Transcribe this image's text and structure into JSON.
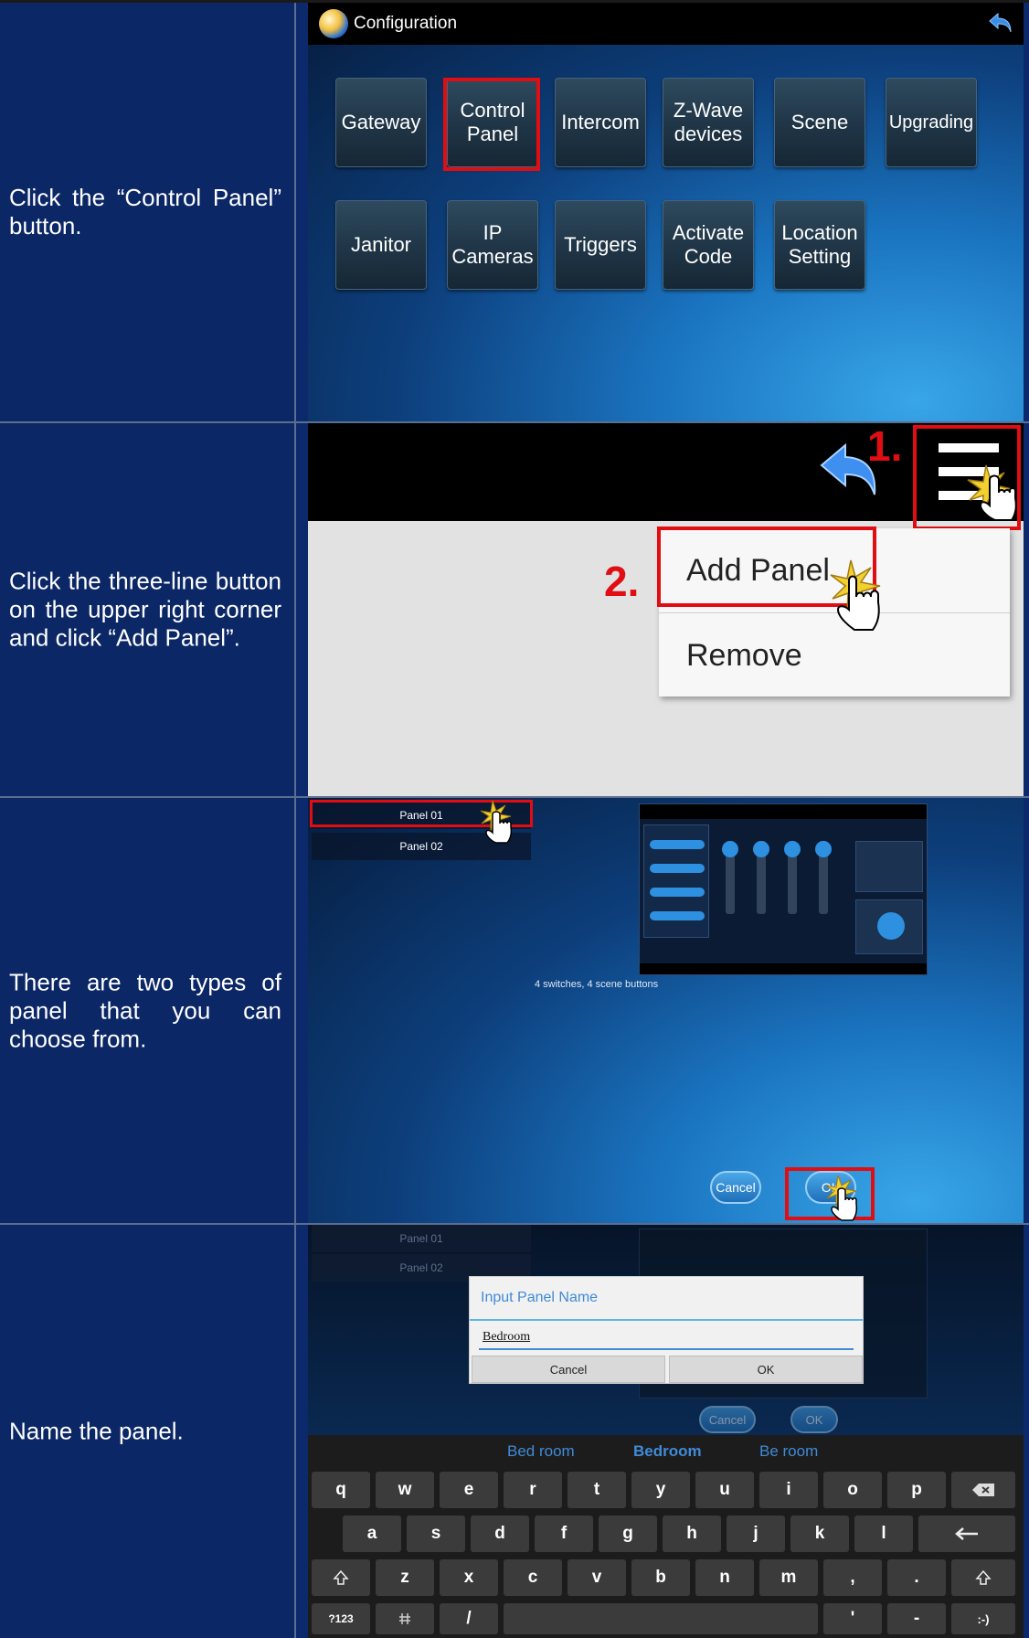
{
  "steps": [
    {
      "description": "Click the “Control Panel” button."
    },
    {
      "description": "Click the three-line button on the upper right corner and click “Add Panel”."
    },
    {
      "description": "There are two types of panel that you can choose from."
    },
    {
      "description": "Name the panel."
    }
  ],
  "config_screen": {
    "title": "Configuration",
    "tiles": [
      {
        "label": "Gateway"
      },
      {
        "label": "Control Panel",
        "highlighted": true
      },
      {
        "label": "Intercom"
      },
      {
        "label": "Z-Wave devices"
      },
      {
        "label": "Scene"
      },
      {
        "label": "Upgrading"
      },
      {
        "label": "Janitor"
      },
      {
        "label": "IP Cameras"
      },
      {
        "label": "Triggers"
      },
      {
        "label": "Activate Code"
      },
      {
        "label": "Location Setting"
      }
    ]
  },
  "menu_screen": {
    "step1_marker": "1.",
    "step2_marker": "2.",
    "items": [
      {
        "label": "Add Panel",
        "highlighted": true
      },
      {
        "label": "Remove"
      }
    ]
  },
  "panel_type_screen": {
    "panel_list": [
      {
        "label": "Panel 01",
        "highlighted": true
      },
      {
        "label": "Panel 02"
      }
    ],
    "preview_caption": "4 switches, 4 scene buttons",
    "cancel_label": "Cancel",
    "ok_label": "OK"
  },
  "name_screen": {
    "panel_list": [
      {
        "label": "Panel 01"
      },
      {
        "label": "Panel 02"
      }
    ],
    "dialog_title": "Input Panel Name",
    "input_value": "Bedroom",
    "dialog_cancel": "Cancel",
    "dialog_ok": "OK",
    "bg_cancel": "Cancel",
    "bg_ok": "OK",
    "suggestions": [
      "Bed room",
      "Bedroom",
      "Be room"
    ],
    "keyboard_rows": [
      [
        "q",
        "w",
        "e",
        "r",
        "t",
        "y",
        "u",
        "i",
        "o",
        "p"
      ],
      [
        "a",
        "s",
        "d",
        "f",
        "g",
        "h",
        "j",
        "k",
        "l"
      ],
      [
        "z",
        "x",
        "c",
        "v",
        "b",
        "n",
        "m",
        ",",
        "."
      ]
    ],
    "key_symbols": "?123",
    "key_slash": "/",
    "key_emoji": ":-)",
    "key_dash": "-",
    "key_apos": "'"
  }
}
